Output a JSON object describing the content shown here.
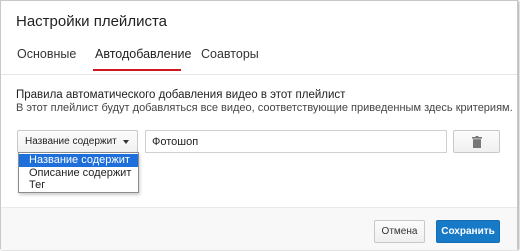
{
  "dialog": {
    "title": "Настройки плейлиста"
  },
  "tabs": [
    {
      "label": "Основные",
      "active": false
    },
    {
      "label": "Автодобавление",
      "active": true
    },
    {
      "label": "Соавторы",
      "active": false
    }
  ],
  "section": {
    "heading": "Правила автоматического добавления видео в этот плейлист",
    "description": "В этот плейлист будут добавляться все видео, соответствующие приведенным здесь критериям."
  },
  "rule": {
    "condition_selected": "Название содержит",
    "value": "Фотошоп",
    "delete_icon": "trash-icon",
    "options": [
      "Название содержит",
      "Описание содержит",
      "Тег"
    ],
    "selected_index": 0
  },
  "footer": {
    "cancel_label": "Отмена",
    "save_label": "Сохранить"
  },
  "colors": {
    "tab_active_underline": "#cc181e",
    "primary_button": "#167ac6",
    "option_highlight": "#1e6fd9"
  }
}
